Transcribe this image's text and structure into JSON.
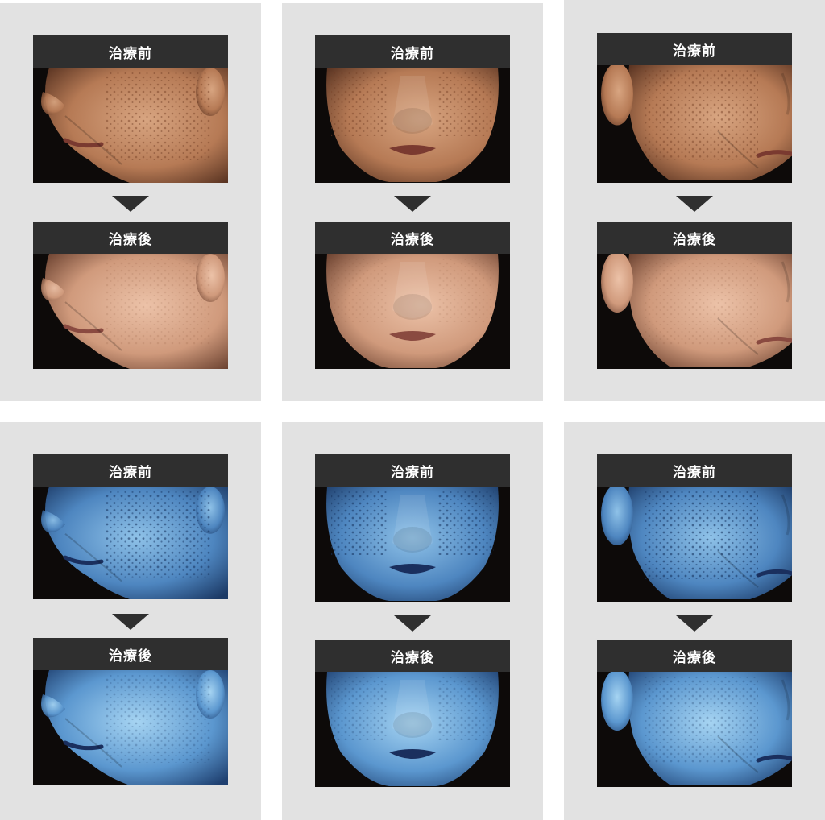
{
  "labels": {
    "before": "治療前",
    "after": "治療後"
  },
  "colors": {
    "panel_bg": "#e2e2e2",
    "label_bg": "#2f2f2f",
    "label_text": "#ffffff"
  },
  "panels": [
    {
      "row": "normal-light",
      "view": "left-oblique",
      "before_label": "治療前",
      "after_label": "治療後"
    },
    {
      "row": "normal-light",
      "view": "frontal",
      "before_label": "治療前",
      "after_label": "治療後"
    },
    {
      "row": "normal-light",
      "view": "right-oblique",
      "before_label": "治療前",
      "after_label": "治療後"
    },
    {
      "row": "uv-light",
      "view": "left-oblique",
      "before_label": "治療前",
      "after_label": "治療後"
    },
    {
      "row": "uv-light",
      "view": "frontal",
      "before_label": "治療前",
      "after_label": "治療後"
    },
    {
      "row": "uv-light",
      "view": "right-oblique",
      "before_label": "治療前",
      "after_label": "治療後"
    }
  ]
}
